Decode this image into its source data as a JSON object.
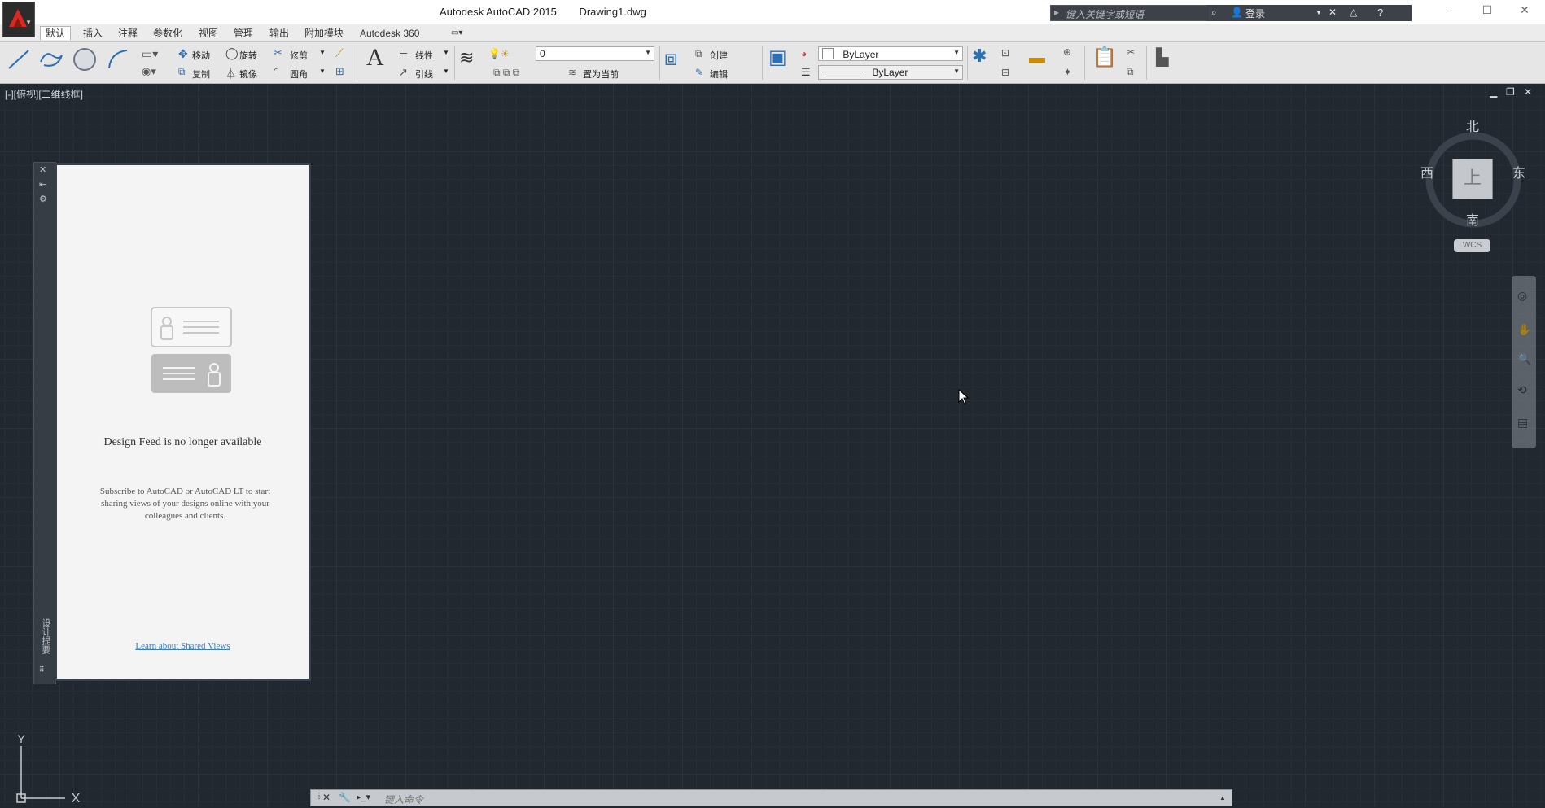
{
  "titlebar": {
    "app_name": "Autodesk AutoCAD 2015",
    "file_name": "Drawing1.dwg",
    "search_placeholder": "键入关键字或短语",
    "login_label": "登录"
  },
  "ribbon_tabs": [
    {
      "label": "默认",
      "active": true
    },
    {
      "label": "插入"
    },
    {
      "label": "注释"
    },
    {
      "label": "参数化"
    },
    {
      "label": "视图"
    },
    {
      "label": "管理"
    },
    {
      "label": "输出"
    },
    {
      "label": "附加模块"
    },
    {
      "label": "Autodesk 360"
    }
  ],
  "ribbon": {
    "modify": {
      "move": "移动",
      "rotate": "旋转",
      "trim": "修剪",
      "copy": "复制",
      "mirror": "镜像",
      "fillet": "圆角"
    },
    "annotation": {
      "linear": "线性",
      "leader": "引线"
    },
    "layers": {
      "layer_value": "0",
      "make_current": "置为当前"
    },
    "block": {
      "create": "创建",
      "edit": "编辑"
    },
    "properties": {
      "color_value": "ByLayer",
      "linetype_value": "ByLayer"
    }
  },
  "viewport": {
    "label": "[-][俯视][二维线框]",
    "viewcube": {
      "north": "北",
      "south": "南",
      "east": "东",
      "west": "西",
      "face": "上"
    },
    "wcs": "WCS",
    "ucs": {
      "y": "Y",
      "x": "X"
    }
  },
  "design_feed": {
    "title": "Design Feed is no longer available",
    "description": "Subscribe to AutoCAD or AutoCAD LT to start sharing views of your designs online with your colleagues and clients.",
    "link": "Learn about Shared Views"
  },
  "command_line": {
    "placeholder": "键入命令"
  },
  "colors": {
    "canvas": "#212830",
    "accent": "#d82a20"
  }
}
